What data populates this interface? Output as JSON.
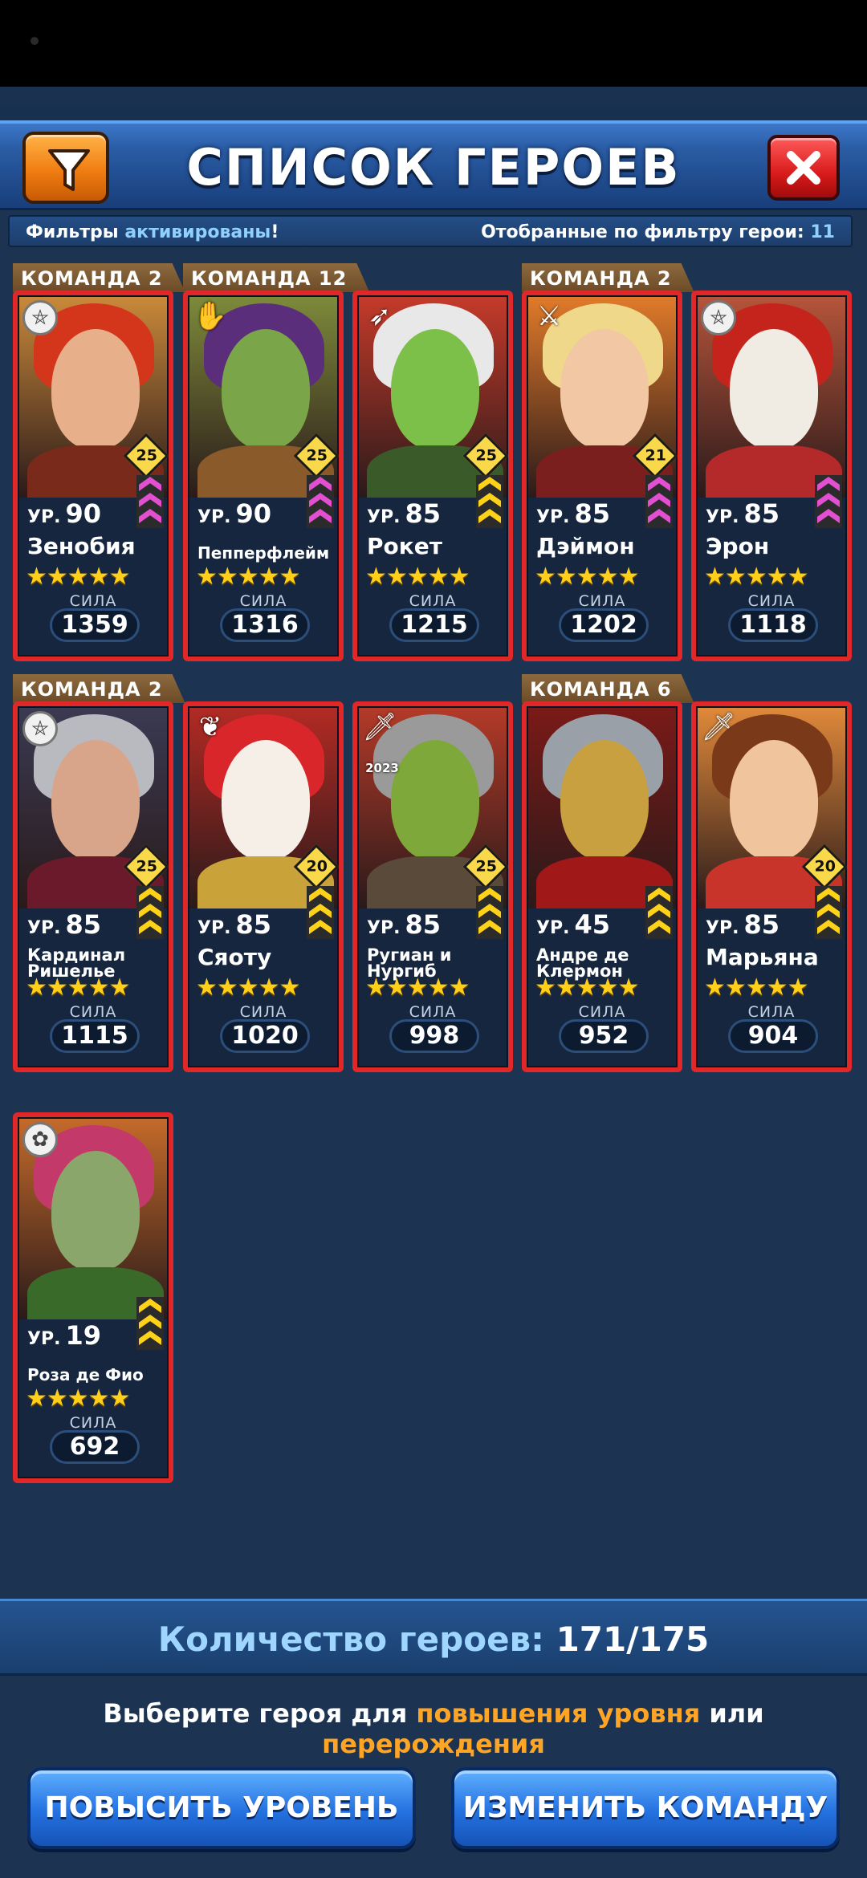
{
  "header": {
    "title": "СПИСОК ГЕРОЕВ",
    "filter_icon": "filter-icon",
    "close_icon": "close-icon"
  },
  "filterbar": {
    "prefix": "Фильтры ",
    "activated": "активированы",
    "suffix": "!",
    "filtered_label": "Отобранные по фильтру герои: ",
    "filtered_count": "11"
  },
  "labels": {
    "level_prefix": "УР.",
    "power": "СИЛА",
    "stars": "★★★★★"
  },
  "heroes": [
    {
      "team": "КОМАНДА 2",
      "level": "90",
      "name": "Зенобия",
      "power": "1359",
      "limit": "25",
      "class_icon": "pentagram-icon",
      "chevron_color": "#e24fd0"
    },
    {
      "team": "КОМАНДА 12",
      "level": "90",
      "name": "Пепперфлейм",
      "power": "1316",
      "limit": "25",
      "class_icon": "hand-icon",
      "chevron_color": "#e24fd0"
    },
    {
      "team": "",
      "level": "85",
      "name": "Рокет",
      "power": "1215",
      "limit": "25",
      "class_icon": "bow-icon",
      "chevron_color": "#ffd21a"
    },
    {
      "team": "КОМАНДА 2",
      "level": "85",
      "name": "Дэймон",
      "power": "1202",
      "limit": "21",
      "class_icon": "crossed-swords-icon",
      "chevron_color": "#e24fd0"
    },
    {
      "team": "",
      "level": "85",
      "name": "Эрон",
      "power": "1118",
      "limit": "",
      "class_icon": "pentagram-icon",
      "chevron_color": "#e24fd0"
    },
    {
      "team": "КОМАНДА 2",
      "level": "85",
      "name": "Кардинал Ришелье",
      "power": "1115",
      "limit": "25",
      "class_icon": "pentagram-icon",
      "chevron_color": "#ffd21a"
    },
    {
      "team": "",
      "level": "85",
      "name": "Сяоту",
      "power": "1020",
      "limit": "20",
      "class_icon": "feather-icon",
      "chevron_color": "#ffd21a"
    },
    {
      "team": "",
      "level": "85",
      "name": "Ругиан и Нургиб",
      "power": "998",
      "limit": "25",
      "class_icon": "sword-icon",
      "chevron_color": "#ffd21a"
    },
    {
      "team": "КОМАНДА 6",
      "level": "45",
      "name": "Андре де Клермон",
      "power": "952",
      "limit": "",
      "class_icon": "",
      "chevron_color": "#ffd21a"
    },
    {
      "team": "",
      "level": "85",
      "name": "Марьяна",
      "power": "904",
      "limit": "20",
      "class_icon": "sword-icon",
      "chevron_color": "#ffd21a"
    },
    {
      "team": "",
      "level": "19",
      "name": "Роза де Фио",
      "power": "692",
      "limit": "",
      "class_icon": "flower-icon",
      "chevron_color": "#ffd21a"
    }
  ],
  "hero_badge_2023": "2023",
  "footer": {
    "count_label": "Количество героев: ",
    "count_value": "171/175",
    "hint_1": "Выберите героя для ",
    "hint_2": "повышения уровня",
    "hint_3": " или ",
    "hint_4": "перерождения",
    "level_up_button": "ПОВЫСИТЬ УРОВЕНЬ",
    "change_team_button": "ИЗМЕНИТЬ КОМАНДУ"
  }
}
